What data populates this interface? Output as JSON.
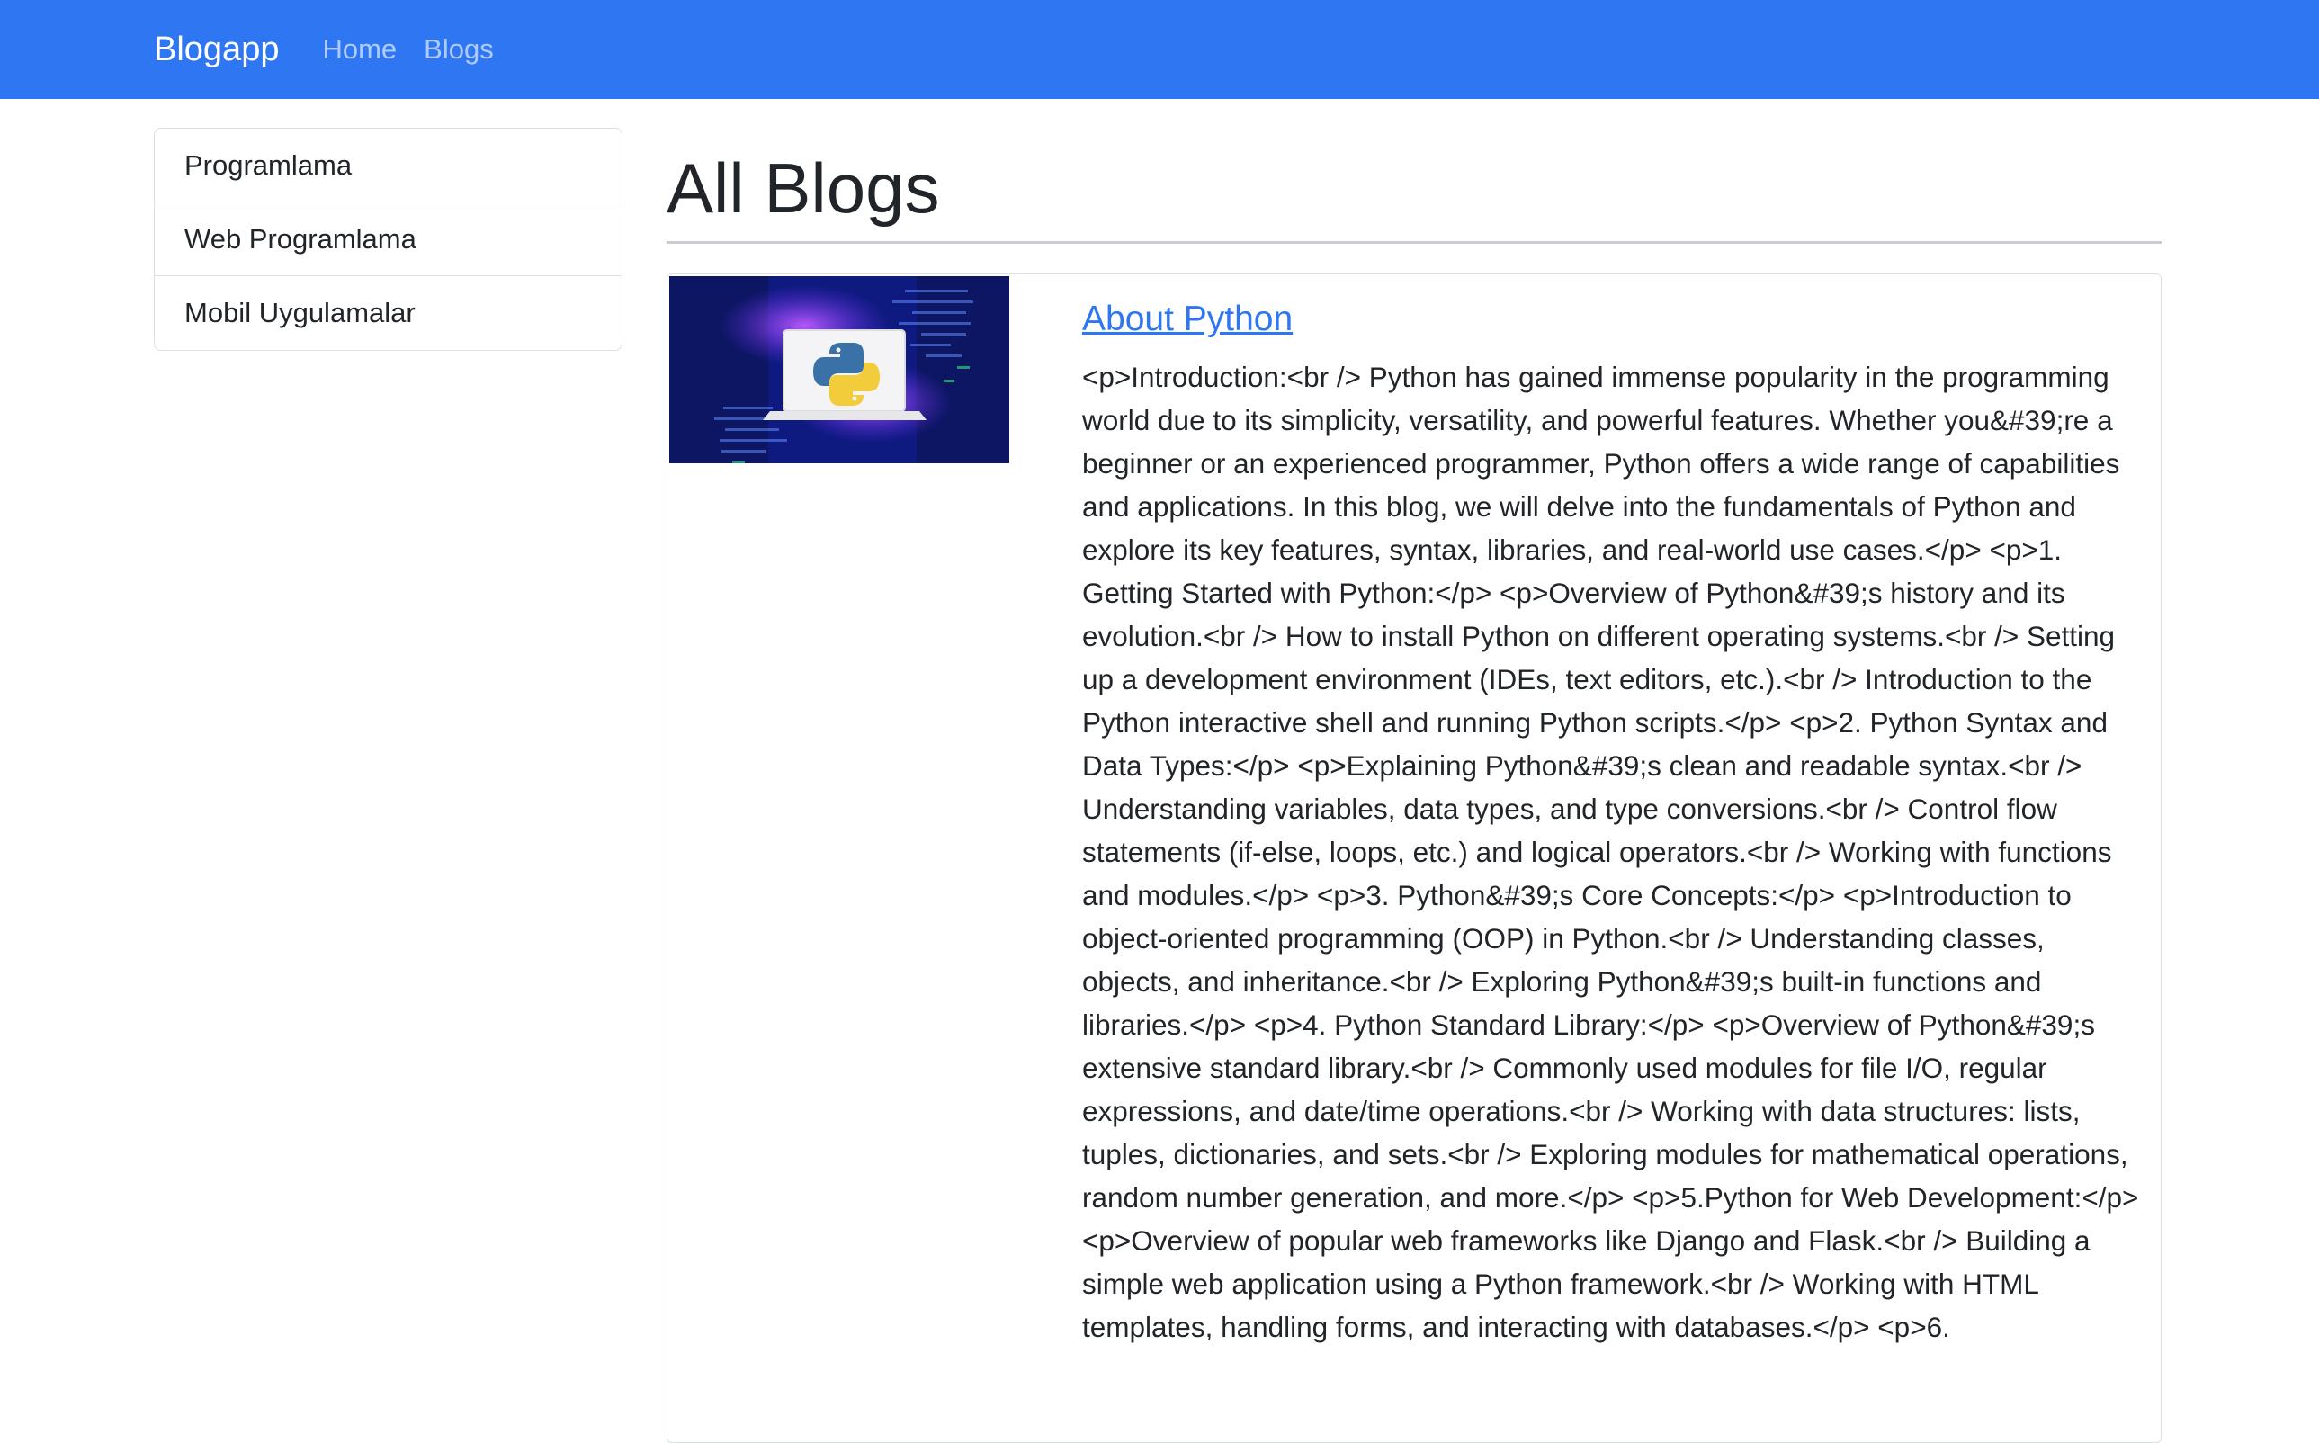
{
  "navbar": {
    "brand": "Blogapp",
    "links": [
      "Home",
      "Blogs"
    ],
    "bg_color": "#2f76f3"
  },
  "sidebar": {
    "categories": [
      "Programlama",
      "Web Programlama",
      "Mobil Uygulamalar"
    ]
  },
  "main": {
    "title": "All Blogs",
    "blog": {
      "title": "About Python",
      "image_icon": "python-logo-laptop",
      "text": "<p>Introduction:<br /> Python has gained immense popularity in the programming world due to its simplicity, versatility, and powerful features. Whether you&#39;re a beginner or an experienced programmer, Python offers a wide range of capabilities and applications. In this blog, we will delve into the fundamentals of Python and explore its key features, syntax, libraries, and real-world use cases.</p> <p>1. Getting Started with Python:</p> <p>Overview of Python&#39;s history and its evolution.<br /> How to install Python on different operating systems.<br /> Setting up a development environment (IDEs, text editors, etc.).<br /> Introduction to the Python interactive shell and running Python scripts.</p> <p>2. Python Syntax and Data Types:</p> <p>Explaining Python&#39;s clean and readable syntax.<br /> Understanding variables, data types, and type conversions.<br /> Control flow statements (if-else, loops, etc.) and logical operators.<br /> Working with functions and modules.</p> <p>3. Python&#39;s Core Concepts:</p> <p>Introduction to object-oriented programming (OOP) in Python.<br /> Understanding classes, objects, and inheritance.<br /> Exploring Python&#39;s built-in functions and libraries.</p> <p>4. Python Standard Library:</p> <p>Overview of Python&#39;s extensive standard library.<br /> Commonly used modules for file I/O, regular expressions, and date/time operations.<br /> Working with data structures: lists, tuples, dictionaries, and sets.<br /> Exploring modules for mathematical operations, random number generation, and more.</p> <p>5.Python for Web Development:</p> <p>Overview of popular web frameworks like Django and Flask.<br /> Building a simple web application using a Python framework.<br /> Working with HTML templates, handling forms, and interacting with databases.</p> <p>6."
    }
  }
}
